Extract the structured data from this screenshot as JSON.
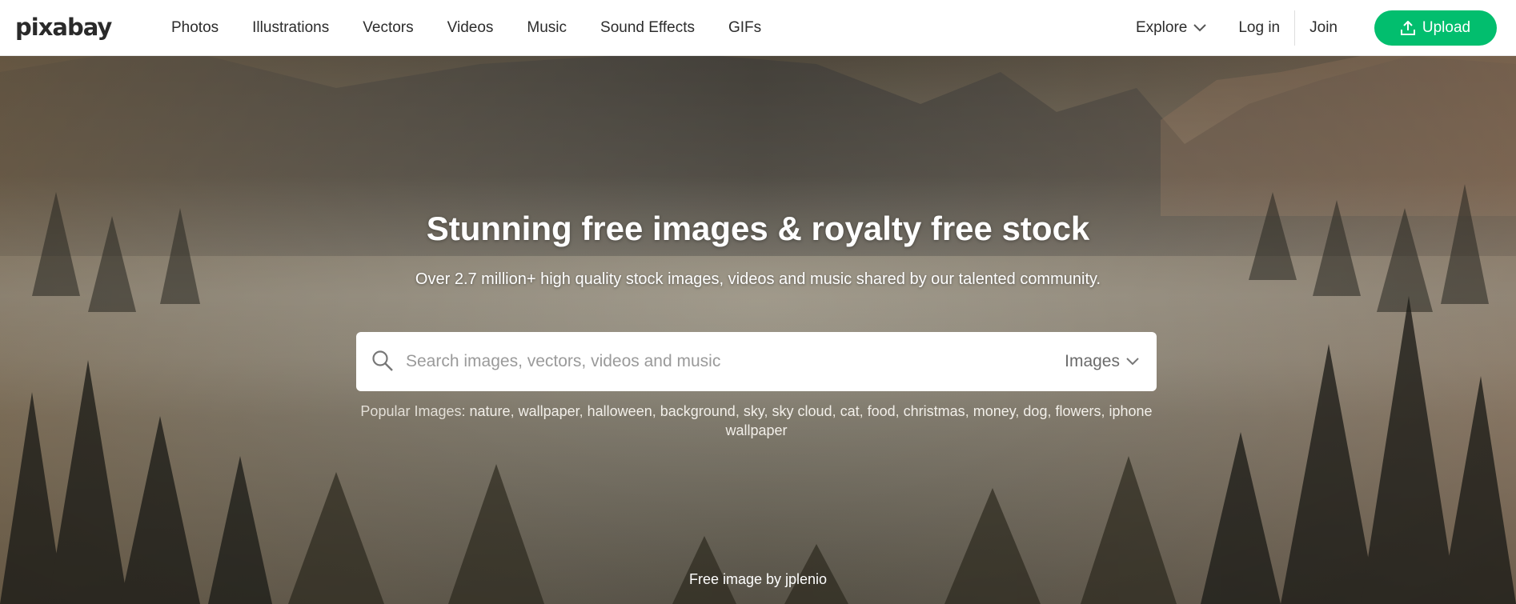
{
  "header": {
    "logo": "pixabay",
    "nav": [
      "Photos",
      "Illustrations",
      "Vectors",
      "Videos",
      "Music",
      "Sound Effects",
      "GIFs"
    ],
    "explore_label": "Explore",
    "login_label": "Log in",
    "join_label": "Join",
    "upload_label": "Upload",
    "accent_color": "#02be6e"
  },
  "hero": {
    "title": "Stunning free images & royalty free stock",
    "subtitle": "Over 2.7 million+ high quality stock images, videos and music shared by our talented community.",
    "search": {
      "placeholder": "Search images, vectors, videos and music",
      "value": "",
      "type_label": "Images"
    },
    "popular": {
      "prefix": "Popular Images:",
      "tags": [
        "nature",
        "wallpaper",
        "halloween",
        "background",
        "sky",
        "sky cloud",
        "cat",
        "food",
        "christmas",
        "money",
        "dog",
        "flowers",
        "iphone wallpaper"
      ]
    },
    "credit": "Free image by jplenio"
  },
  "icons": {
    "search": "search-icon",
    "chevron": "chevron-down-icon",
    "upload": "upload-icon"
  }
}
